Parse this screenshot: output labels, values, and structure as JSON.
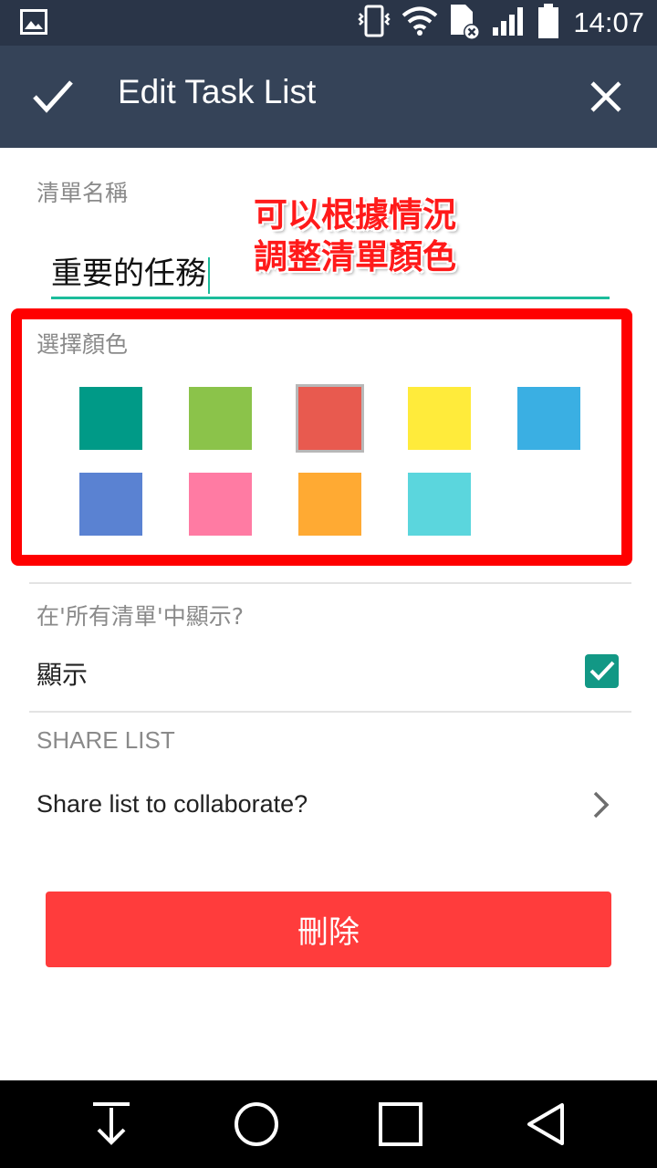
{
  "status_bar": {
    "time": "14:07",
    "icons": [
      "gallery-icon",
      "vibrate-icon",
      "wifi-icon",
      "no-sim-icon",
      "signal-icon",
      "battery-icon"
    ]
  },
  "app_bar": {
    "title": "Edit Task List",
    "confirm_icon": "check-icon",
    "close_icon": "close-icon"
  },
  "list_name": {
    "label": "清單名稱",
    "value": "重要的任務"
  },
  "annotation": {
    "line1": "可以根據情況",
    "line2": "調整清單顏色",
    "color": "#ff1a1a"
  },
  "color_picker": {
    "label": "選擇顏色",
    "selected_index": 2,
    "colors": [
      "#009a87",
      "#8bc34a",
      "#e85a4f",
      "#ffeb3b",
      "#3aafe3",
      "#5a82d2",
      "#ff7ba3",
      "#ffaa33",
      "#5bd6dd"
    ]
  },
  "show_in_all": {
    "label": "在'所有清單'中顯示?",
    "option_label": "顯示",
    "checked": true
  },
  "share": {
    "header": "SHARE LIST",
    "row_label": "Share list to collaborate?"
  },
  "delete_button": {
    "label": "刪除",
    "color": "#ff3c3c"
  },
  "nav_bar": {
    "icons": [
      "notification-pull-icon",
      "home-icon",
      "recents-icon",
      "back-icon"
    ]
  },
  "accent_color": "#1bbc9b"
}
